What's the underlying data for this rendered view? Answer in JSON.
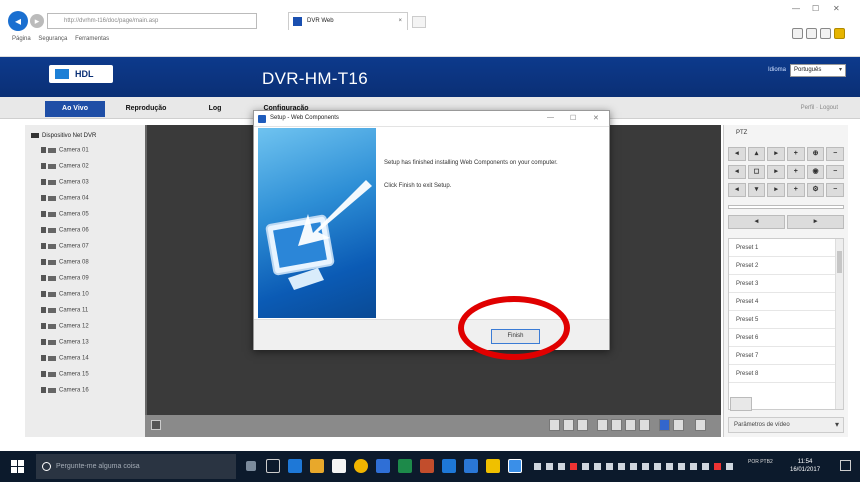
{
  "browser": {
    "address": "http://dvrhm-t16/doc/page/main.asp",
    "tab_title": "DVR Web",
    "command_bar": [
      "Página",
      "Segurança",
      "Ferramentas"
    ]
  },
  "header": {
    "logo_text": "HDL",
    "title": "DVR-HM-T16",
    "language_label": "Idioma",
    "language_value": "Português"
  },
  "menu": {
    "tabs": [
      "Ao Vivo",
      "Reprodução",
      "Log",
      "Configuração"
    ],
    "top_right": "Perfil · Logout"
  },
  "left_panel": {
    "root": "Dispositivo Net DVR",
    "cameras": [
      "Camera 01",
      "Camera 02",
      "Camera 03",
      "Camera 04",
      "Camera 05",
      "Camera 06",
      "Camera 07",
      "Camera 08",
      "Camera 09",
      "Camera 10",
      "Camera 11",
      "Camera 12",
      "Camera 13",
      "Camera 14",
      "Camera 15",
      "Camera 16"
    ]
  },
  "ptz": {
    "label": "PTZ",
    "rows": [
      [
        "◂",
        "▴",
        "▸",
        "+",
        "⊕",
        "−"
      ],
      [
        "◂",
        "◻",
        "▸",
        "+",
        "◉",
        "−"
      ],
      [
        "◂",
        "▾",
        "▸",
        "+",
        "⚙",
        "−"
      ]
    ],
    "row4": [
      "◂",
      "▸"
    ]
  },
  "presets": [
    "Preset 1",
    "Preset 2",
    "Preset 3",
    "Preset 4",
    "Preset 5",
    "Preset 6",
    "Preset 7",
    "Preset 8"
  ],
  "video_params_label": "Parâmetros de vídeo",
  "dialog": {
    "title": "Setup - Web Components",
    "text1": "Setup has finished installing Web Components on your computer.",
    "text2": "Click Finish to exit Setup.",
    "finish_label": "Finish"
  },
  "taskbar": {
    "search_placeholder": "Pergunte-me alguma coisa",
    "clock_time": "11:54",
    "clock_date": "16/01/2017",
    "tray_lang": "POR PTB2"
  }
}
